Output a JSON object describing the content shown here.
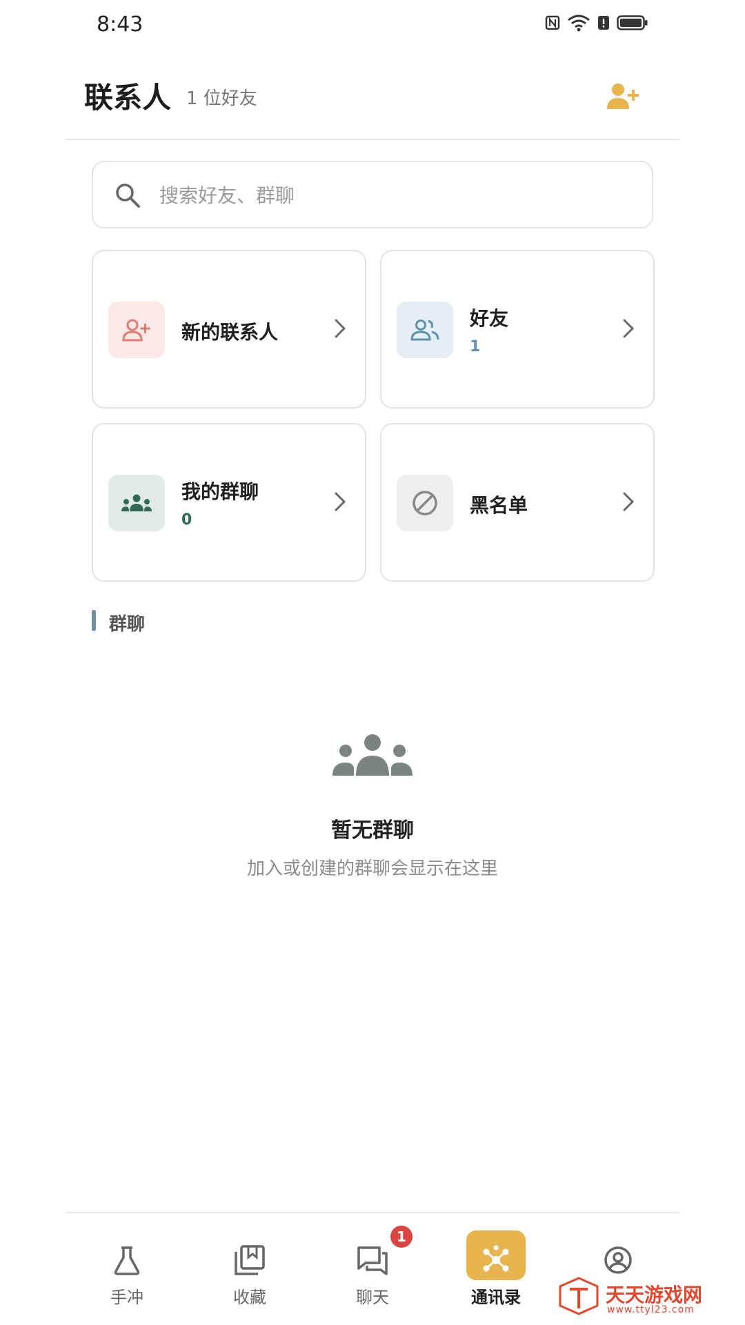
{
  "status_bar": {
    "time": "8:43"
  },
  "header": {
    "title": "联系人",
    "subtitle": "1 位好友"
  },
  "search": {
    "placeholder": "搜索好友、群聊"
  },
  "cards": {
    "new_contacts": {
      "label": "新的联系人",
      "icon": "person-add-icon",
      "color": "#e57b70",
      "bg": "#fbe9e7"
    },
    "friends": {
      "label": "好友",
      "count": "1",
      "icon": "people-icon",
      "color": "#5f90ae",
      "bg": "#e5eef3"
    },
    "my_groups": {
      "label": "我的群聊",
      "count": "0",
      "icon": "group-icon",
      "color": "#2f6a59",
      "bg": "#e3eaea"
    },
    "blacklist": {
      "label": "黑名单",
      "icon": "block-icon",
      "color": "#888888",
      "bg": "#eeeeee"
    }
  },
  "section": {
    "label": "群聊"
  },
  "empty_state": {
    "title": "暂无群聊",
    "description": "加入或创建的群聊会显示在这里"
  },
  "bottom_nav": {
    "items": [
      {
        "label": "手冲",
        "icon": "flask-icon"
      },
      {
        "label": "收藏",
        "icon": "bookmark-icon"
      },
      {
        "label": "聊天",
        "icon": "chat-icon",
        "badge": "1"
      },
      {
        "label": "通讯录",
        "icon": "network-icon",
        "active": true
      },
      {
        "label": "",
        "icon": "profile-icon"
      }
    ]
  },
  "watermark": {
    "text": "天天游戏网",
    "url": "www.ttyl23.com"
  },
  "colors": {
    "accent": "#e8b44d",
    "badge": "#d9453f"
  }
}
